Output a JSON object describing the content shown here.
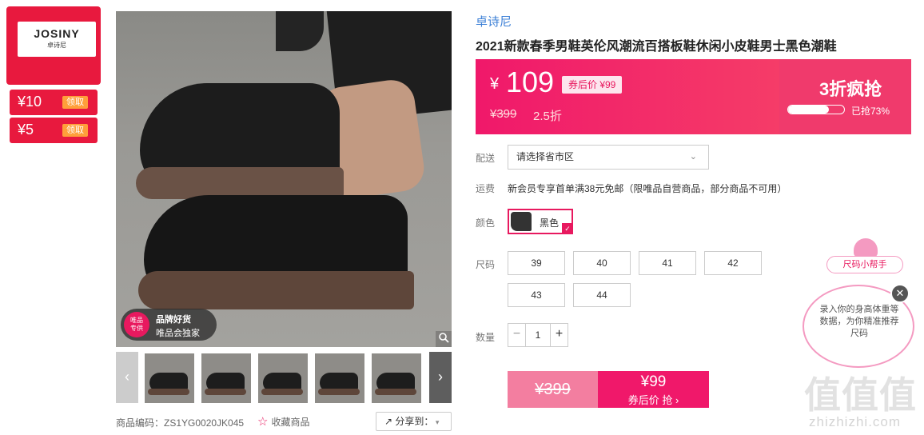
{
  "brand_logo": {
    "main": "JOSINY",
    "sub": "卓诗尼"
  },
  "coupons": [
    {
      "amount": "¥10",
      "action": "领取"
    },
    {
      "amount": "¥5",
      "action": "领取"
    }
  ],
  "gallery": {
    "badge_circle": "唯品\n专供",
    "badge_line1": "品牌好货",
    "badge_line2": "唯品会独家",
    "zoom_icon": "🔍",
    "prev_icon": "‹",
    "next_icon": "›",
    "thumb_count": 6
  },
  "footer": {
    "item_code": "商品编码：ZS1YG0020JK045",
    "favorite": "收藏商品",
    "share": "分享到："
  },
  "product": {
    "brand": "卓诗尼",
    "title": "2021新款春季男鞋英伦风潮流百搭板鞋休闲小皮鞋男士黑色潮鞋"
  },
  "price": {
    "currency": "¥",
    "value": "109",
    "after_coupon": "券后价 ¥99",
    "original": "¥399",
    "discount": "2.5折",
    "flash_sale": "3折疯抢",
    "progress_fraction": 0.73,
    "progress_text": "已抢73%"
  },
  "delivery": {
    "label": "配送",
    "placeholder": "请选择省市区",
    "chevron_icon": "chevron-down"
  },
  "shipping": {
    "label": "运费",
    "text": "新会员专享首单满38元免邮（限唯品自营商品，部分商品不可用）"
  },
  "color": {
    "label": "颜色",
    "selected": "黑色"
  },
  "size": {
    "label": "尺码",
    "options": [
      "39",
      "40",
      "41",
      "42",
      "43",
      "44"
    ]
  },
  "quantity": {
    "label": "数量",
    "value": "1"
  },
  "buy": {
    "original": "¥399",
    "price": "¥99",
    "action": "券后价 抢 ›"
  },
  "size_helper": {
    "tag": "尺码小帮手",
    "text": "录入你的身高体重等数据，为你精准推荐尺码",
    "close_icon": "✕"
  },
  "watermark": {
    "main": "值值值",
    "sub": "zhizhizhi.com"
  },
  "colors": {
    "accent": "#e8195f",
    "coupon_red": "#e8193e",
    "brand_link": "#3b7fd6"
  }
}
